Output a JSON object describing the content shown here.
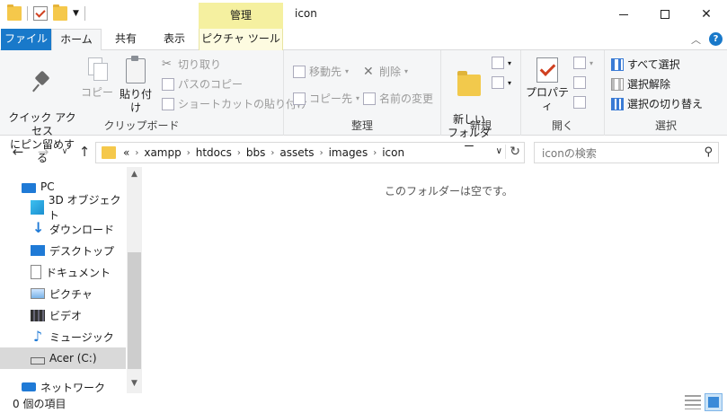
{
  "window": {
    "title": "icon",
    "context_tab_header": "管理"
  },
  "ribbon_tabs": {
    "file": "ファイル",
    "home": "ホーム",
    "share": "共有",
    "view": "表示",
    "picture_tools": "ピクチャ ツール"
  },
  "clipboard": {
    "pin_label": "クイック アクセス\nにピン留めする",
    "copy_label": "コピー",
    "paste_label": "貼り付け",
    "cut_label": "切り取り",
    "copy_path_label": "パスのコピー",
    "paste_shortcut_label": "ショートカットの貼り付け",
    "group_label": "クリップボード"
  },
  "organize": {
    "move_label": "移動先",
    "copy_to_label": "コピー先",
    "delete_label": "削除",
    "rename_label": "名前の変更",
    "group_label": "整理"
  },
  "new_group": {
    "new_folder_label": "新しい\nフォルダー",
    "group_label": "新規"
  },
  "open_group": {
    "properties_label": "プロパティ",
    "group_label": "開く"
  },
  "select_group": {
    "select_all": "すべて選択",
    "select_none": "選択解除",
    "invert": "選択の切り替え",
    "group_label": "選択"
  },
  "address": {
    "overflow": "«",
    "crumbs": [
      "xampp",
      "htdocs",
      "bbs",
      "assets",
      "images",
      "icon"
    ]
  },
  "search": {
    "placeholder": "iconの検索"
  },
  "nav_pane": {
    "items": [
      {
        "label": "PC"
      },
      {
        "label": "3D オブジェクト"
      },
      {
        "label": "ダウンロード"
      },
      {
        "label": "デスクトップ"
      },
      {
        "label": "ドキュメント"
      },
      {
        "label": "ピクチャ"
      },
      {
        "label": "ビデオ"
      },
      {
        "label": "ミュージック"
      },
      {
        "label": "Acer (C:)"
      },
      {
        "label": "ネットワーク"
      }
    ]
  },
  "content": {
    "empty_message": "このフォルダーは空です。"
  },
  "status": {
    "item_count": "0 個の項目"
  }
}
